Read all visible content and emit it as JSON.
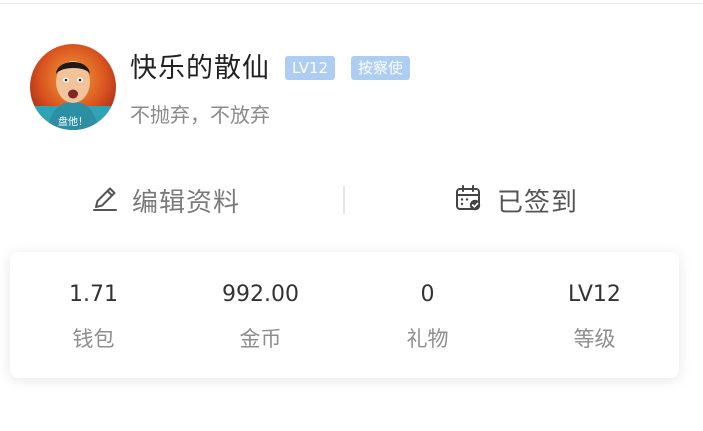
{
  "profile": {
    "username": "快乐的散仙",
    "level_badge": "LV12",
    "title_badge": "按察使",
    "motto": "不抛弃，不放弃",
    "avatar_caption": "盘他！"
  },
  "actions": {
    "edit": {
      "label": "编辑资料",
      "icon": "pencil-icon"
    },
    "checkin": {
      "label": "已签到",
      "icon": "calendar-check-icon"
    }
  },
  "stats": [
    {
      "value": "1.71",
      "label": "钱包"
    },
    {
      "value": "992.00",
      "label": "金币"
    },
    {
      "value": "0",
      "label": "礼物"
    },
    {
      "value": "LV12",
      "label": "等级"
    }
  ],
  "colors": {
    "badge": "#aecdf3",
    "primary_text": "#222222",
    "secondary_text": "#8a8a8a"
  }
}
